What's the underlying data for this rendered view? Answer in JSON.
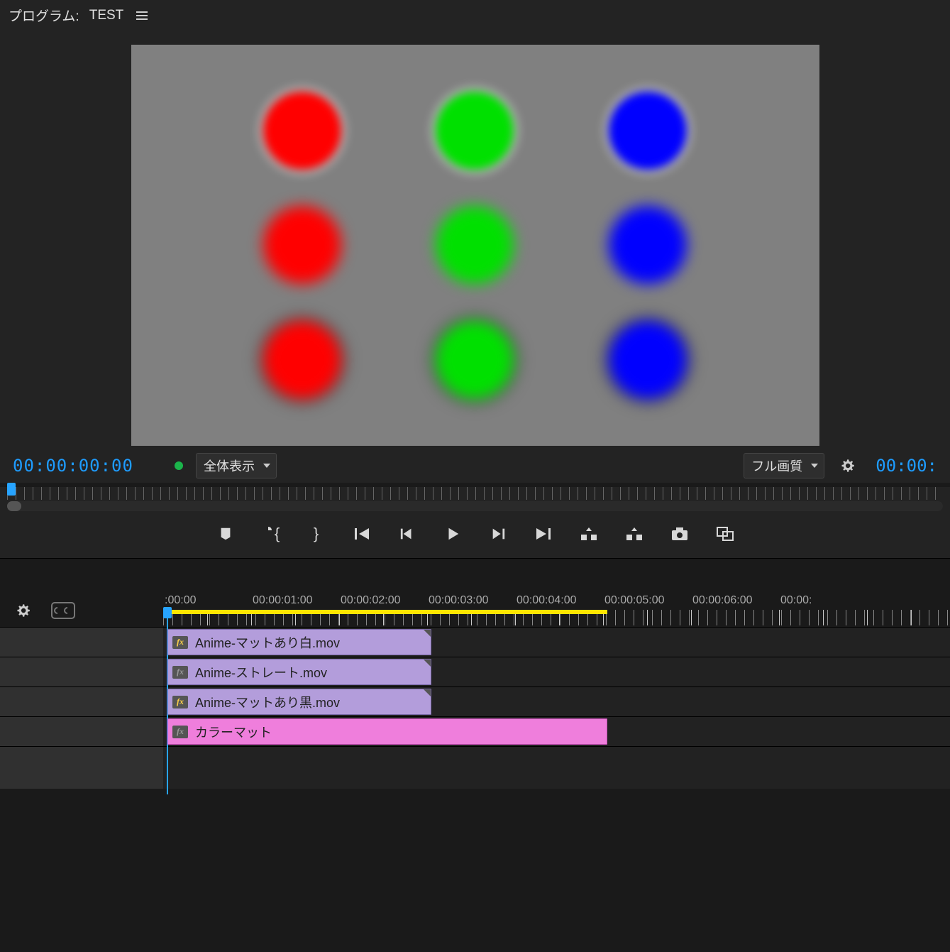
{
  "header": {
    "panel_label": "プログラム:",
    "sequence_name": "TEST"
  },
  "infobar": {
    "timecode_left": "00:00:00:00",
    "zoom_select": "全体表示",
    "quality_select": "フル画質",
    "timecode_right": "00:00:"
  },
  "timeline": {
    "ruler_start": ":00:00",
    "ticks": [
      "00:00:01:00",
      "00:00:02:00",
      "00:00:03:00",
      "00:00:04:00",
      "00:00:05:00",
      "00:00:06:00",
      "00:00:"
    ],
    "yellow_bar_end_tc": "00:00:05:00",
    "clips": [
      {
        "name": "Anime-マットあり白.mov",
        "fx": "y",
        "end_tc": "00:00:03:00",
        "color": "violet"
      },
      {
        "name": "Anime-ストレート.mov",
        "fx": "g",
        "end_tc": "00:00:03:00",
        "color": "violet"
      },
      {
        "name": "Anime-マットあり黒.mov",
        "fx": "y",
        "end_tc": "00:00:03:00",
        "color": "violet"
      },
      {
        "name": "カラーマット",
        "fx": "g",
        "end_tc": "00:00:05:00",
        "color": "pink"
      }
    ]
  },
  "preview": {
    "grid_colors": [
      "red",
      "green",
      "blue"
    ],
    "rows_style": [
      "white-halo",
      "soft",
      "black-halo"
    ]
  }
}
